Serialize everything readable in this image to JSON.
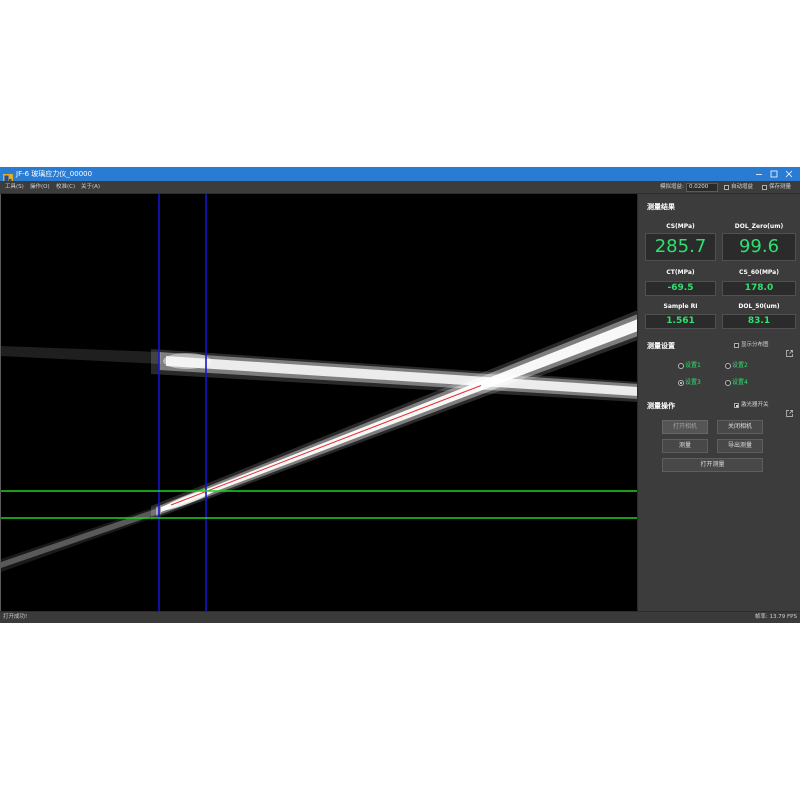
{
  "window": {
    "title": "JF-6 玻璃应力仪_00000"
  },
  "menu": {
    "items": [
      "工具(S)",
      "操作(O)",
      "校准(C)",
      "关于(A)"
    ]
  },
  "toolbar": {
    "gain_label": "模拟增益:",
    "gain_value": "0.0200",
    "auto_gain": {
      "label": "自动增益",
      "checked": false
    },
    "save_measure": {
      "label": "保存测量",
      "checked": false
    }
  },
  "results": {
    "heading": "测量结果",
    "items": [
      {
        "label": "CS(MPa)",
        "value": "285.7"
      },
      {
        "label": "DOL_Zero(um)",
        "value": "99.6"
      },
      {
        "label": "CT(MPa)",
        "value": "-69.5"
      },
      {
        "label": "CS_60(MPa)",
        "value": "178.0"
      },
      {
        "label": "Sample RI",
        "value": "1.561"
      },
      {
        "label": "DOL_50(um)",
        "value": "83.1"
      }
    ]
  },
  "settings": {
    "heading": "测量设置",
    "show_distribution": {
      "label": "显示分布图",
      "checked": false
    },
    "options": [
      "设置1",
      "设置2",
      "设置3",
      "设置4"
    ],
    "selected": "设置3"
  },
  "operations": {
    "heading": "测量操作",
    "laser_switch": {
      "label": "激光器开关",
      "checked": true
    },
    "buttons": [
      {
        "label": "打开相机",
        "enabled": false
      },
      {
        "label": "关闭相机",
        "enabled": true
      },
      {
        "label": "测量",
        "enabled": true
      },
      {
        "label": "导出测量",
        "enabled": true
      },
      {
        "label": "打开测量",
        "enabled": true
      }
    ]
  },
  "status": {
    "message": "打开成功!",
    "frame_rate": "帧率: 13.79 FPS"
  },
  "icons": {
    "app": "app-icon",
    "minimize": "minimize-icon",
    "maximize": "maximize-icon",
    "close": "close-icon",
    "export": "export-icon",
    "checkbox": "checkbox-icon",
    "radio": "radio-icon"
  },
  "colors": {
    "title_bar": "#2a7bd2",
    "value_green": "#2fe06f",
    "cursor_blue": "#1515cf",
    "cursor_green": "#1fd31f",
    "fit_line_red": "#e53030"
  }
}
